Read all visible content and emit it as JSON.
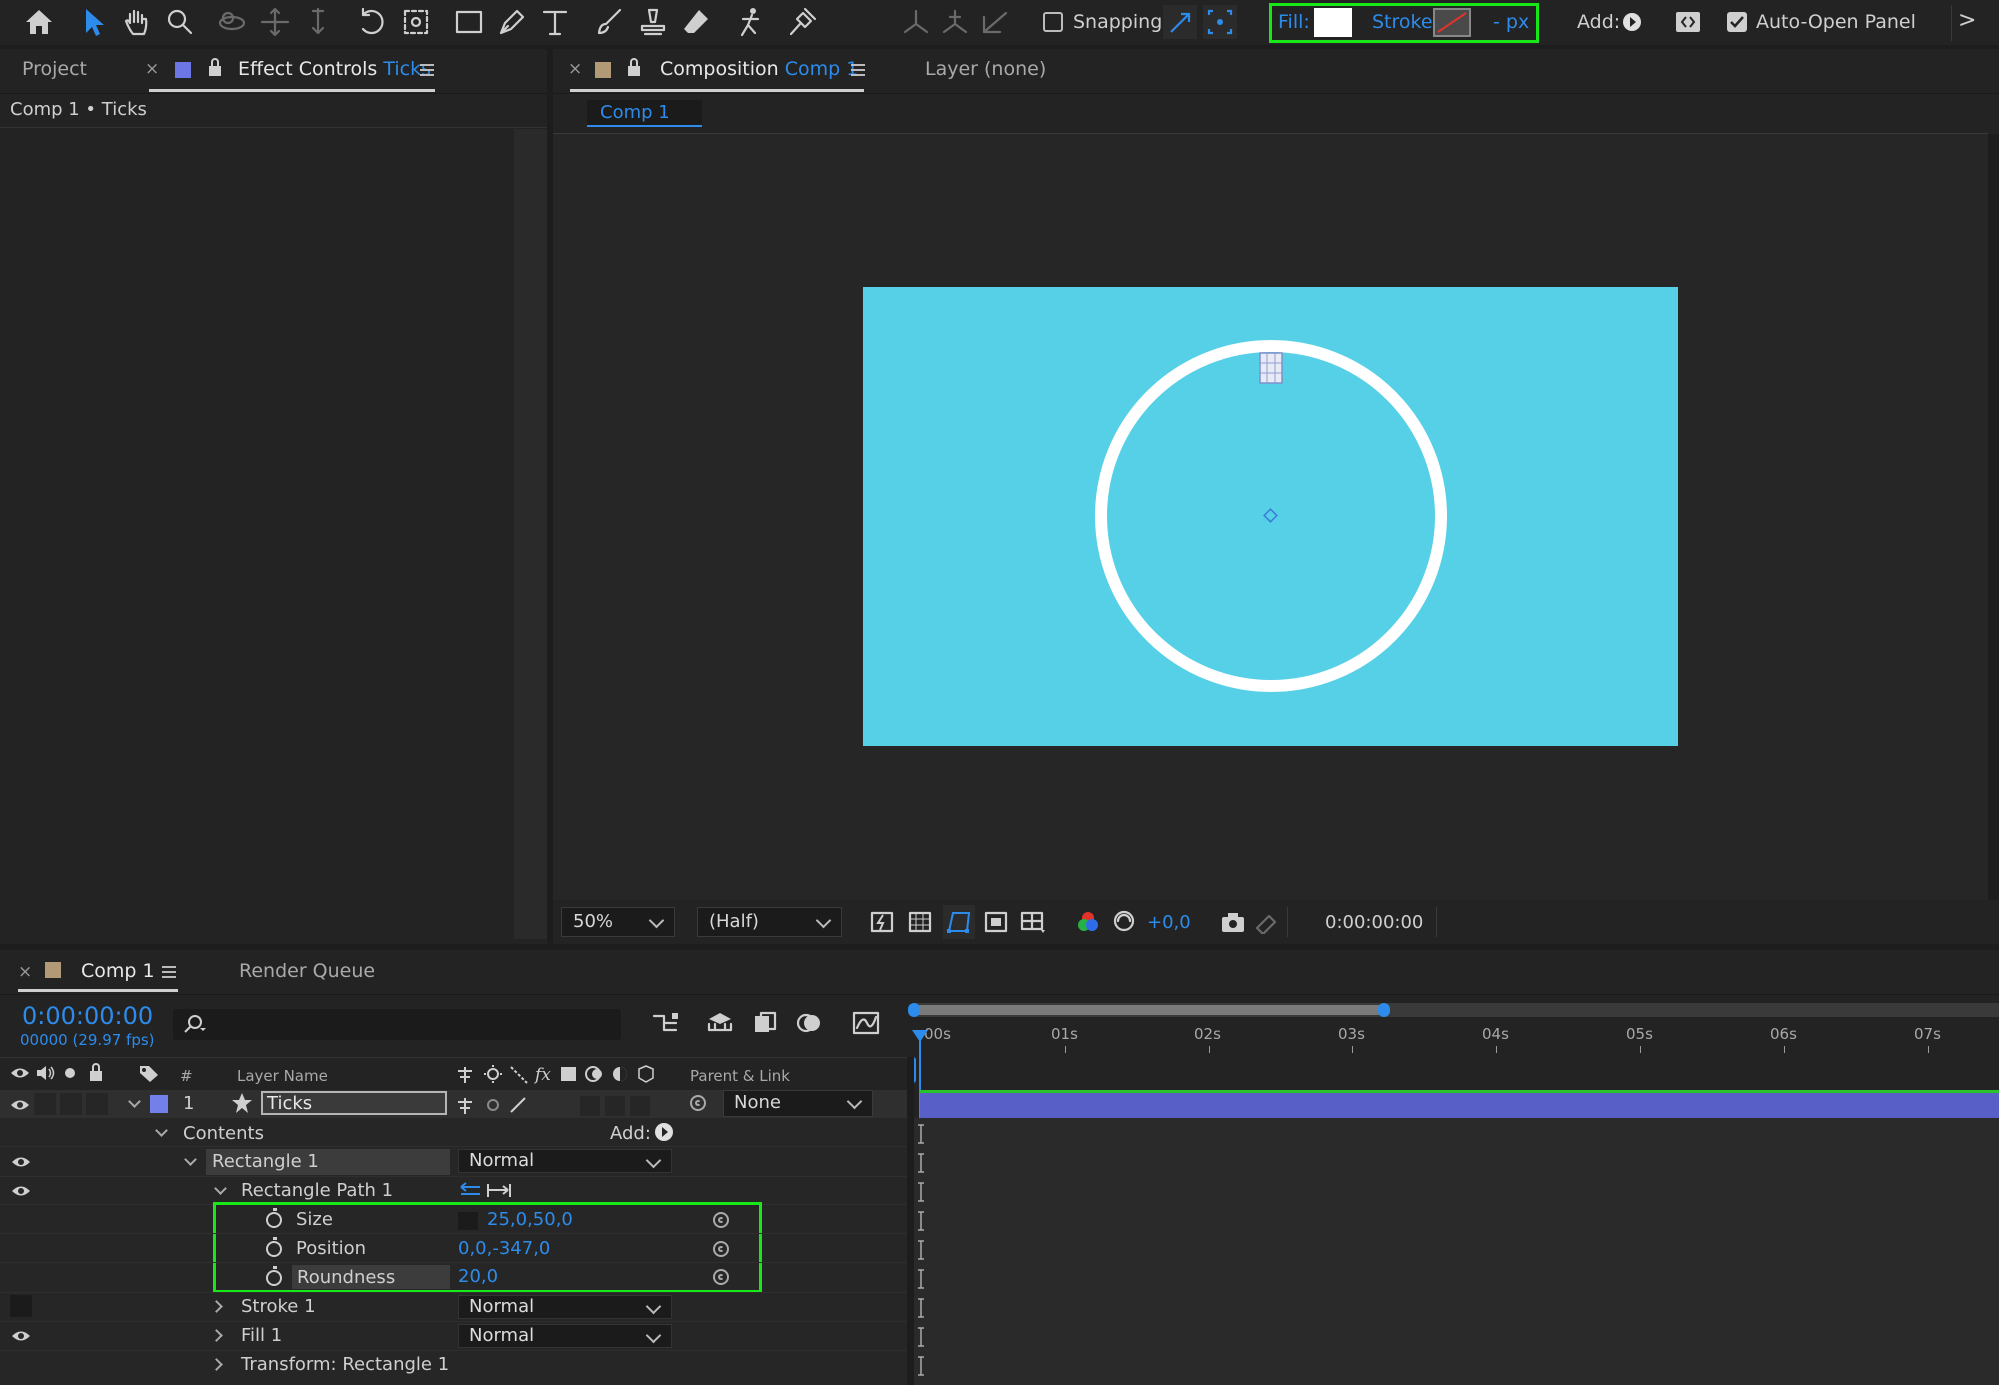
{
  "toolbar": {
    "snapping_label": "Snapping",
    "fill_label": "Fill:",
    "stroke_label": "Stroke:",
    "stroke_width": "- px",
    "add_label": "Add:",
    "auto_open_label": "Auto-Open Panel",
    "overflow": ">"
  },
  "left_panel": {
    "tab_project": "Project",
    "tab_effect_controls": "Effect Controls",
    "tab_effect_layer": "Ticks",
    "breadcrumb": "Comp 1 • Ticks",
    "close": "×"
  },
  "viewer": {
    "tab_composition": "Composition",
    "tab_comp_name": "Comp 1",
    "tab_layer": "Layer (none)",
    "close": "×",
    "subtab": "Comp 1",
    "zoom": "50%",
    "resolution": "(Half)",
    "exposure": "+0,0",
    "timecode": "0:00:00:00",
    "canvas_color": "#56d0e6"
  },
  "timeline": {
    "tab_comp": "Comp 1",
    "tab_render": "Render Queue",
    "close": "×",
    "current_time": "0:00:00:00",
    "frame_info": "00000 (29.97 fps)",
    "columns": {
      "number": "#",
      "layer_name": "Layer Name",
      "fx": "fx",
      "parent": "Parent & Link"
    },
    "ruler": [
      "00s",
      "01s",
      "02s",
      "03s",
      "04s",
      "05s",
      "06s",
      "07s"
    ],
    "layer": {
      "number": "1",
      "name": "Ticks",
      "parent": "None",
      "label_color": "#7380ea"
    },
    "contents_label": "Contents",
    "add_label": "Add:",
    "rectangle_group": "Rectangle 1",
    "rectangle_mode": "Normal",
    "rect_path": "Rectangle Path 1",
    "props": [
      {
        "name": "Size",
        "value": "25,0,50,0"
      },
      {
        "name": "Position",
        "value": "0,0,-347,0"
      },
      {
        "name": "Roundness",
        "value": "20,0"
      }
    ],
    "stroke": {
      "name": "Stroke 1",
      "mode": "Normal"
    },
    "fill": {
      "name": "Fill 1",
      "mode": "Normal"
    },
    "transform": "Transform: Rectangle 1"
  }
}
